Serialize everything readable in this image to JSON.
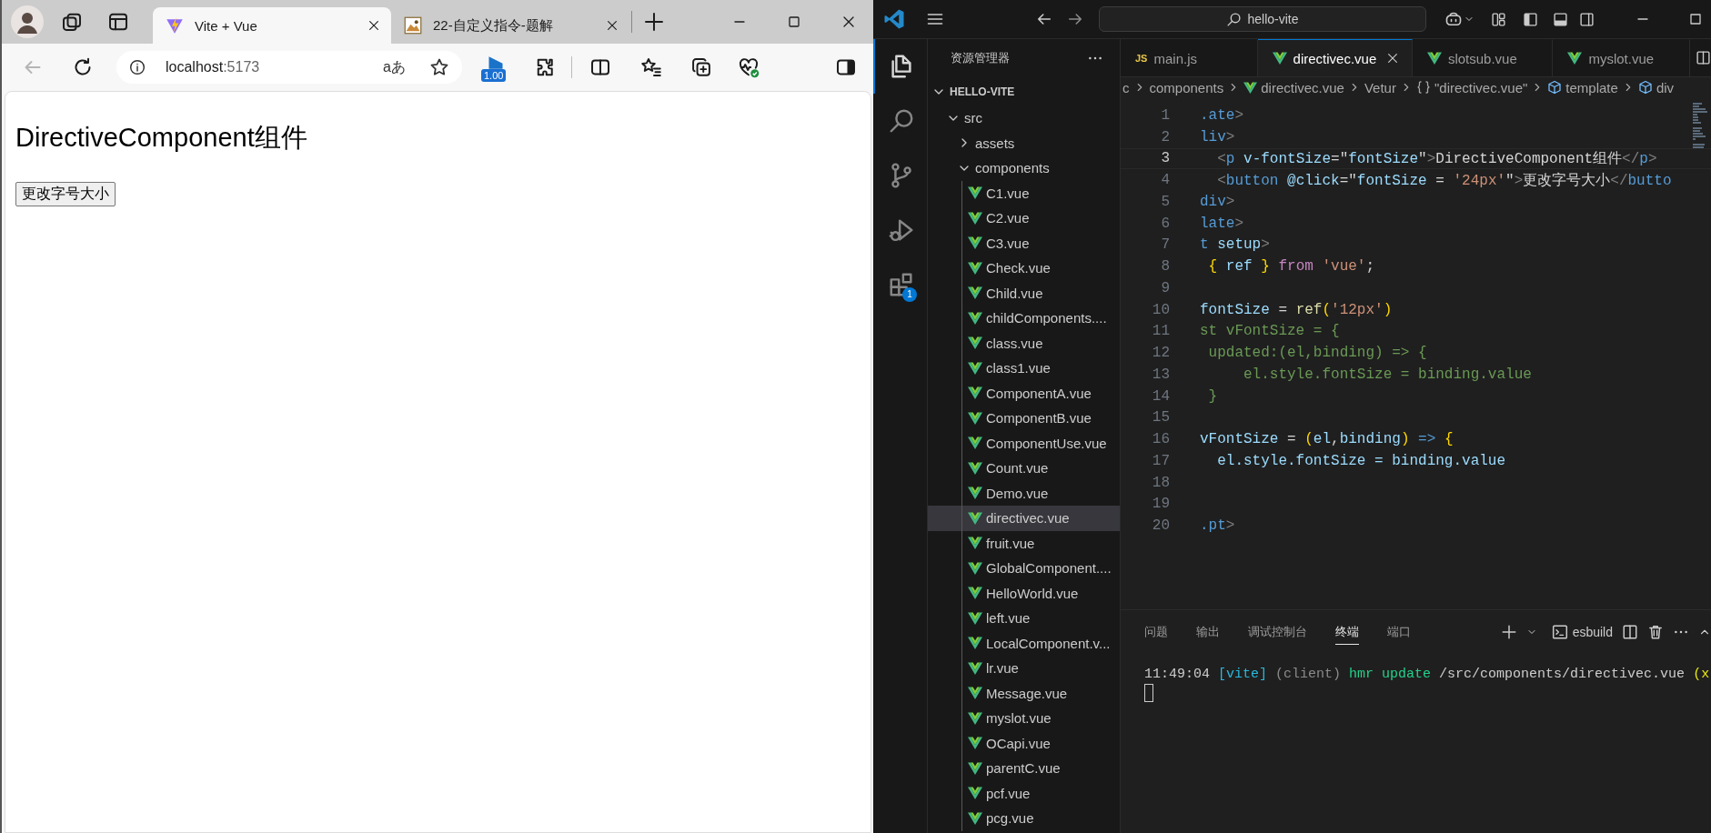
{
  "browser": {
    "tabs": [
      {
        "title": "Vite + Vue",
        "selected": true,
        "kind": "vite"
      },
      {
        "title": "22-自定义指令-题解",
        "selected": false,
        "kind": "picture"
      }
    ],
    "address": {
      "host": "localhost",
      "port": ":5173"
    },
    "read_aloud": "aあ",
    "extension_badge": "1.00",
    "page": {
      "heading": "DirectiveComponent组件",
      "button": "更改字号大小"
    }
  },
  "vscode": {
    "search": "hello-vite",
    "activity": [
      {
        "kind": "files",
        "selected": true
      },
      {
        "kind": "search",
        "selected": false
      },
      {
        "kind": "git",
        "selected": false
      },
      {
        "kind": "debug",
        "selected": false
      },
      {
        "kind": "extensions",
        "selected": false,
        "badge": "1"
      }
    ],
    "explorer": {
      "title": "资源管理器",
      "root": "HELLO-VITE",
      "tree": [
        {
          "name": "src",
          "selected": false,
          "expanded": true,
          "children": [
            {
              "name": "assets",
              "selected": false,
              "expanded": false
            },
            {
              "name": "components",
              "selected": false,
              "expanded": true,
              "children": [
                {
                  "name": "C1.vue",
                  "selected": false
                },
                {
                  "name": "C2.vue",
                  "selected": false
                },
                {
                  "name": "C3.vue",
                  "selected": false
                },
                {
                  "name": "Check.vue",
                  "selected": false
                },
                {
                  "name": "Child.vue",
                  "selected": false
                },
                {
                  "name": "childComponents....",
                  "selected": false
                },
                {
                  "name": "class.vue",
                  "selected": false
                },
                {
                  "name": "class1.vue",
                  "selected": false
                },
                {
                  "name": "ComponentA.vue",
                  "selected": false
                },
                {
                  "name": "ComponentB.vue",
                  "selected": false
                },
                {
                  "name": "ComponentUse.vue",
                  "selected": false
                },
                {
                  "name": "Count.vue",
                  "selected": false
                },
                {
                  "name": "Demo.vue",
                  "selected": false
                },
                {
                  "name": "directivec.vue",
                  "selected": true
                },
                {
                  "name": "fruit.vue",
                  "selected": false
                },
                {
                  "name": "GlobalComponent....",
                  "selected": false
                },
                {
                  "name": "HelloWorld.vue",
                  "selected": false
                },
                {
                  "name": "left.vue",
                  "selected": false
                },
                {
                  "name": "LocalComponent.v...",
                  "selected": false
                },
                {
                  "name": "lr.vue",
                  "selected": false
                },
                {
                  "name": "Message.vue",
                  "selected": false
                },
                {
                  "name": "myslot.vue",
                  "selected": false
                },
                {
                  "name": "OCapi.vue",
                  "selected": false
                },
                {
                  "name": "parentC.vue",
                  "selected": false
                },
                {
                  "name": "pcf.vue",
                  "selected": false
                },
                {
                  "name": "pcg.vue",
                  "selected": false
                }
              ]
            }
          ]
        }
      ]
    },
    "tabs": [
      {
        "label": "main.js",
        "kind": "js",
        "badge": "JS",
        "selected": false
      },
      {
        "label": "directivec.vue",
        "kind": "vue",
        "selected": true
      },
      {
        "label": "slotsub.vue",
        "kind": "vue",
        "selected": false
      },
      {
        "label": "myslot.vue",
        "kind": "vue",
        "selected": false
      }
    ],
    "breadcrumb": [
      {
        "text": "c",
        "kind": "plain"
      },
      {
        "text": "components",
        "kind": "plain"
      },
      {
        "text": "directivec.vue",
        "kind": "vue"
      },
      {
        "text": "Vetur",
        "kind": "plain"
      },
      {
        "text": "\"directivec.vue\"",
        "kind": "braces"
      },
      {
        "text": "template",
        "kind": "cube"
      },
      {
        "text": "div",
        "kind": "cube"
      }
    ],
    "code": [
      {
        "number": "1",
        "current": false,
        "tokens": [
          {
            "text": ".ate",
            "color": "#569cd6"
          },
          {
            "text": ">",
            "color": "#808080"
          }
        ]
      },
      {
        "number": "2",
        "current": false,
        "tokens": [
          {
            "text": "liv",
            "color": "#569cd6"
          },
          {
            "text": ">",
            "color": "#808080"
          }
        ]
      },
      {
        "number": "3",
        "current": true,
        "tokens": [
          {
            "text": "  <",
            "color": "#808080"
          },
          {
            "text": "p",
            "color": "#569cd6"
          },
          {
            "text": " v-fontSize",
            "color": "#9cdcfe"
          },
          {
            "text": "=\"",
            "color": "#d4d4d4"
          },
          {
            "text": "fontSize",
            "color": "#9cdcfe"
          },
          {
            "text": "\"",
            "color": "#d4d4d4"
          },
          {
            "text": ">",
            "color": "#808080"
          },
          {
            "text": "DirectiveComponent组件",
            "color": "#d4d4d4"
          },
          {
            "text": "</",
            "color": "#808080"
          },
          {
            "text": "p",
            "color": "#569cd6"
          },
          {
            "text": ">",
            "color": "#808080"
          }
        ]
      },
      {
        "number": "4",
        "current": false,
        "tokens": [
          {
            "text": "  <",
            "color": "#808080"
          },
          {
            "text": "button",
            "color": "#569cd6"
          },
          {
            "text": " @click",
            "color": "#9cdcfe"
          },
          {
            "text": "=\"",
            "color": "#d4d4d4"
          },
          {
            "text": "fontSize",
            "color": "#9cdcfe"
          },
          {
            "text": " = ",
            "color": "#d4d4d4"
          },
          {
            "text": "'24px'",
            "color": "#ce9178"
          },
          {
            "text": "\"",
            "color": "#d4d4d4"
          },
          {
            "text": ">",
            "color": "#808080"
          },
          {
            "text": "更改字号大小",
            "color": "#d4d4d4"
          },
          {
            "text": "</",
            "color": "#808080"
          },
          {
            "text": "butto",
            "color": "#569cd6"
          }
        ]
      },
      {
        "number": "5",
        "current": false,
        "tokens": [
          {
            "text": "div",
            "color": "#569cd6"
          },
          {
            "text": ">",
            "color": "#808080"
          }
        ]
      },
      {
        "number": "6",
        "current": false,
        "tokens": [
          {
            "text": "late",
            "color": "#569cd6"
          },
          {
            "text": ">",
            "color": "#808080"
          }
        ]
      },
      {
        "number": "7",
        "current": false,
        "tokens": [
          {
            "text": "t",
            "color": "#569cd6"
          },
          {
            "text": " setup",
            "color": "#9cdcfe"
          },
          {
            "text": ">",
            "color": "#808080"
          }
        ]
      },
      {
        "number": "8",
        "current": false,
        "tokens": [
          {
            "text": " {",
            "color": "#ffd700"
          },
          {
            "text": " ref ",
            "color": "#9cdcfe"
          },
          {
            "text": "}",
            "color": "#ffd700"
          },
          {
            "text": " from",
            "color": "#c586c0"
          },
          {
            "text": " 'vue'",
            "color": "#ce9178"
          },
          {
            "text": ";",
            "color": "#d4d4d4"
          }
        ]
      },
      {
        "number": "9",
        "current": false
      },
      {
        "number": "10",
        "current": false,
        "tokens": [
          {
            "text": "fontSize",
            "color": "#9cdcfe"
          },
          {
            "text": " = ",
            "color": "#d4d4d4"
          },
          {
            "text": "ref",
            "color": "#dcdcaa"
          },
          {
            "text": "(",
            "color": "#ffd700"
          },
          {
            "text": "'12px'",
            "color": "#ce9178"
          },
          {
            "text": ")",
            "color": "#ffd700"
          }
        ]
      },
      {
        "number": "11",
        "current": false,
        "tokens": [
          {
            "text": "st vFontSize = {",
            "color": "#6a9955"
          }
        ]
      },
      {
        "number": "12",
        "current": false,
        "tokens": [
          {
            "text": " updated:(el,binding) => {",
            "color": "#6a9955"
          }
        ]
      },
      {
        "number": "13",
        "current": false,
        "tokens": [
          {
            "text": "     el.style.fontSize = binding.value",
            "color": "#6a9955"
          }
        ]
      },
      {
        "number": "14",
        "current": false,
        "tokens": [
          {
            "text": " }",
            "color": "#6a9955"
          }
        ]
      },
      {
        "number": "15",
        "current": false
      },
      {
        "number": "16",
        "current": false,
        "tokens": [
          {
            "text": "vFontSize",
            "color": "#9cdcfe"
          },
          {
            "text": " = ",
            "color": "#d4d4d4"
          },
          {
            "text": "(",
            "color": "#ffd700"
          },
          {
            "text": "el",
            "color": "#9cdcfe"
          },
          {
            "text": ",",
            "color": "#d4d4d4"
          },
          {
            "text": "binding",
            "color": "#9cdcfe"
          },
          {
            "text": ")",
            "color": "#ffd700"
          },
          {
            "text": " =>",
            "color": "#569cd6"
          },
          {
            "text": " {",
            "color": "#ffd700"
          }
        ]
      },
      {
        "number": "17",
        "current": false,
        "tokens": [
          {
            "text": "  el.style.fontSize = binding.value",
            "color": "#9cdcfe"
          }
        ]
      },
      {
        "number": "18",
        "current": false
      },
      {
        "number": "19",
        "current": false
      },
      {
        "number": "20",
        "current": false,
        "tokens": [
          {
            "text": ".pt",
            "color": "#569cd6"
          },
          {
            "text": ">",
            "color": "#808080"
          }
        ]
      }
    ],
    "panel": {
      "tabs": [
        {
          "label": "问题",
          "selected": false
        },
        {
          "label": "输出",
          "selected": false
        },
        {
          "label": "调试控制台",
          "selected": false
        },
        {
          "label": "终端",
          "selected": true
        },
        {
          "label": "端口",
          "selected": false
        }
      ],
      "profile": "esbuild",
      "terminal": [
        {
          "text": "11:49:04 ",
          "color": "#cccccc"
        },
        {
          "text": "[vite]",
          "color": "#29b8db"
        },
        {
          "text": " (client)",
          "color": "#8a8a8a"
        },
        {
          "text": " hmr update",
          "color": "#23d18b"
        },
        {
          "text": " /src/components/directivec.vue ",
          "color": "#cccccc"
        },
        {
          "text": "(x",
          "color": "#e5e510"
        }
      ]
    }
  }
}
